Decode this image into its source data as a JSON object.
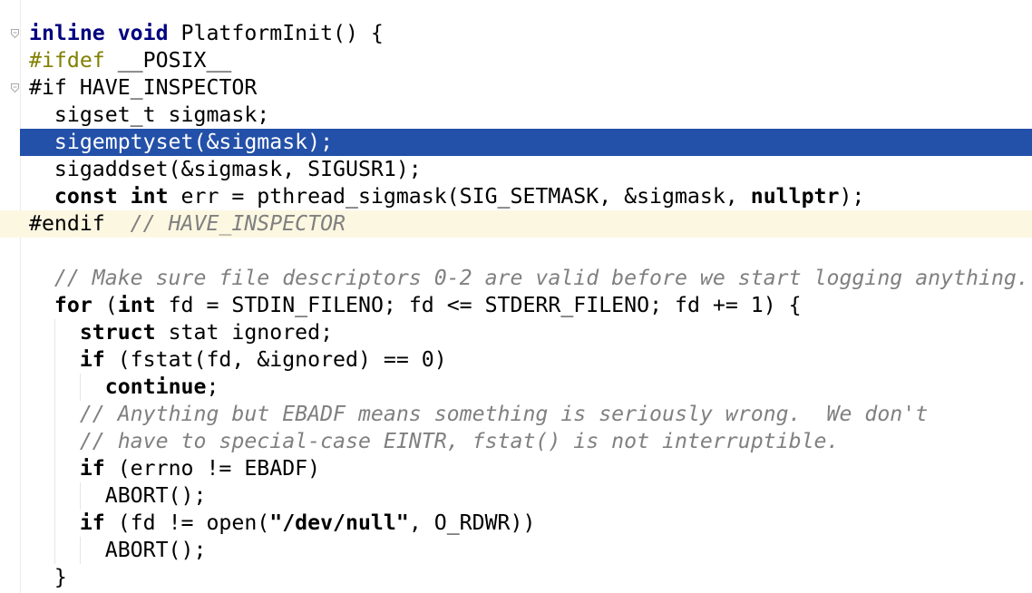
{
  "editor": {
    "lines": [
      [
        {
          "t": "inline void",
          "c": "kw"
        },
        {
          "t": " PlatformInit() {",
          "c": ""
        }
      ],
      [
        {
          "t": "#ifdef",
          "c": "pp"
        },
        {
          "t": " __POSIX__",
          "c": ""
        }
      ],
      [
        {
          "t": "#if HAVE_INSPECTOR",
          "c": ""
        }
      ],
      [
        {
          "t": "  sigset_t sigmask;",
          "c": ""
        }
      ],
      [
        {
          "t": "  sigemptyset(&sigmask);",
          "c": ""
        }
      ],
      [
        {
          "t": "  sigaddset(&sigmask, SIGUSR1);",
          "c": ""
        }
      ],
      [
        {
          "t": "  ",
          "c": ""
        },
        {
          "t": "const int",
          "c": "kwd"
        },
        {
          "t": " err = pthread_sigmask(SIG_SETMASK, &sigmask, ",
          "c": ""
        },
        {
          "t": "nullptr",
          "c": "kwd"
        },
        {
          "t": ");",
          "c": ""
        }
      ],
      [
        {
          "t": "#endif",
          "c": ""
        },
        {
          "t": "  // HAVE_INSPECTOR",
          "c": "cm"
        }
      ],
      [
        {
          "t": "",
          "c": ""
        }
      ],
      [
        {
          "t": "  ",
          "c": ""
        },
        {
          "t": "// Make sure file descriptors 0-2 are valid before we start logging anything.",
          "c": "cm"
        }
      ],
      [
        {
          "t": "  ",
          "c": ""
        },
        {
          "t": "for",
          "c": "kwd"
        },
        {
          "t": " (",
          "c": ""
        },
        {
          "t": "int",
          "c": "kwd"
        },
        {
          "t": " fd = STDIN_FILENO; fd <= STDERR_FILENO; fd += 1) {",
          "c": ""
        }
      ],
      [
        {
          "t": "    ",
          "c": ""
        },
        {
          "t": "struct",
          "c": "kwd"
        },
        {
          "t": " stat ignored;",
          "c": ""
        }
      ],
      [
        {
          "t": "    ",
          "c": ""
        },
        {
          "t": "if",
          "c": "kwd"
        },
        {
          "t": " (fstat(fd, &ignored) == 0)",
          "c": ""
        }
      ],
      [
        {
          "t": "      ",
          "c": ""
        },
        {
          "t": "continue",
          "c": "kwd"
        },
        {
          "t": ";",
          "c": ""
        }
      ],
      [
        {
          "t": "    ",
          "c": ""
        },
        {
          "t": "// Anything but EBADF means something is seriously wrong.  We don't",
          "c": "cm"
        }
      ],
      [
        {
          "t": "    ",
          "c": ""
        },
        {
          "t": "// have to special-case EINTR, fstat() is not interruptible.",
          "c": "cm"
        }
      ],
      [
        {
          "t": "    ",
          "c": ""
        },
        {
          "t": "if",
          "c": "kwd"
        },
        {
          "t": " (errno != EBADF)",
          "c": ""
        }
      ],
      [
        {
          "t": "      ABORT();",
          "c": ""
        }
      ],
      [
        {
          "t": "    ",
          "c": ""
        },
        {
          "t": "if",
          "c": "kwd"
        },
        {
          "t": " (fd != open(",
          "c": ""
        },
        {
          "t": "\"/dev/null\"",
          "c": "kwd"
        },
        {
          "t": ", O_RDWR))",
          "c": ""
        }
      ],
      [
        {
          "t": "      ABORT();",
          "c": ""
        }
      ],
      [
        {
          "t": "  }",
          "c": ""
        }
      ]
    ],
    "selected_line_index": 4,
    "current_line_index": 7,
    "fold_marker_lines": [
      0,
      2
    ]
  }
}
